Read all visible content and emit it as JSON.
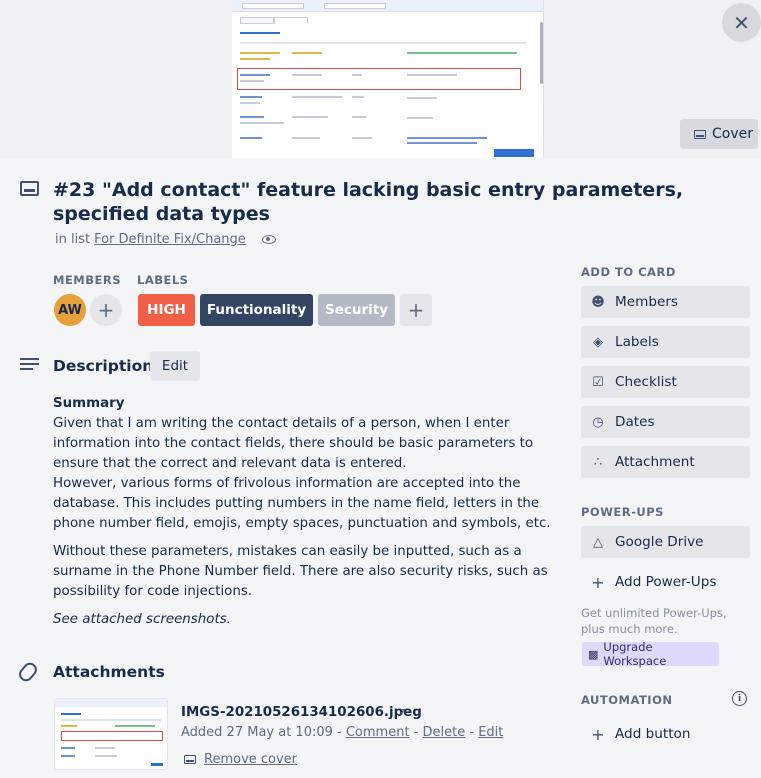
{
  "cover": {
    "button_label": "Cover",
    "close_symbol": "✕"
  },
  "card": {
    "title": "#23 \"Add contact\" feature lacking basic entry parameters, specified data types",
    "list_prefix": "in list",
    "list_name": "For Definite Fix/Change"
  },
  "members": {
    "heading": "MEMBERS",
    "avatar_initials": "AW",
    "add_symbol": "+"
  },
  "labels": {
    "heading": "LABELS",
    "items": [
      {
        "text": "HIGH",
        "color": "#f15f46"
      },
      {
        "text": "Functionality",
        "color": "#344563"
      },
      {
        "text": "Security",
        "color": "#b3bac5"
      }
    ],
    "add_symbol": "+"
  },
  "description": {
    "heading": "Description",
    "edit_label": "Edit",
    "summary_heading": "Summary",
    "paragraph1": "Given that I am writing the contact details of a person, when I enter information into the contact fields, there should be basic parameters to ensure that the correct and relevant data is entered.",
    "paragraph2": "However, various forms of frivolous information are accepted into the database. This includes putting numbers in the name field, letters in the phone number field, emojis, empty spaces, punctuation and symbols, etc.",
    "paragraph3": "Without these parameters, mistakes can easily be inputted, such as a surname in the Phone Number field. There are also security risks, such as possibility for code injections.",
    "note": "See attached screenshots."
  },
  "attachments": {
    "heading": "Attachments",
    "file_name": "IMGS-20210526134102606.jpeg",
    "external_symbol": "↗",
    "added_text": "Added 27 May at 10:09 - ",
    "comment_link": "Comment",
    "separator1": " - ",
    "delete_link": "Delete",
    "separator2": " - ",
    "edit_link": "Edit",
    "remove_cover": "Remove cover"
  },
  "sidebar": {
    "add_to_card_heading": "ADD TO CARD",
    "add_to_card": [
      {
        "label": "Members",
        "icon": "person-icon"
      },
      {
        "label": "Labels",
        "icon": "tag-icon"
      },
      {
        "label": "Checklist",
        "icon": "checklist-icon"
      },
      {
        "label": "Dates",
        "icon": "clock-icon"
      },
      {
        "label": "Attachment",
        "icon": "paperclip-icon"
      }
    ],
    "power_ups_heading": "POWER-UPS",
    "google_drive": "Google Drive",
    "add_power_ups": "Add Power-Ups",
    "promo": "Get unlimited Power-Ups, plus much more.",
    "upgrade": "Upgrade Workspace",
    "automation_heading": "AUTOMATION",
    "add_button": "Add button"
  },
  "colors": {
    "page_bg": "#f4f5f7",
    "button_bg": "#e4e6ea",
    "text": "#172b4d",
    "muted": "#5e6c84",
    "avatar": "#e8a13a",
    "upgrade_bg": "#dfd8fd"
  }
}
